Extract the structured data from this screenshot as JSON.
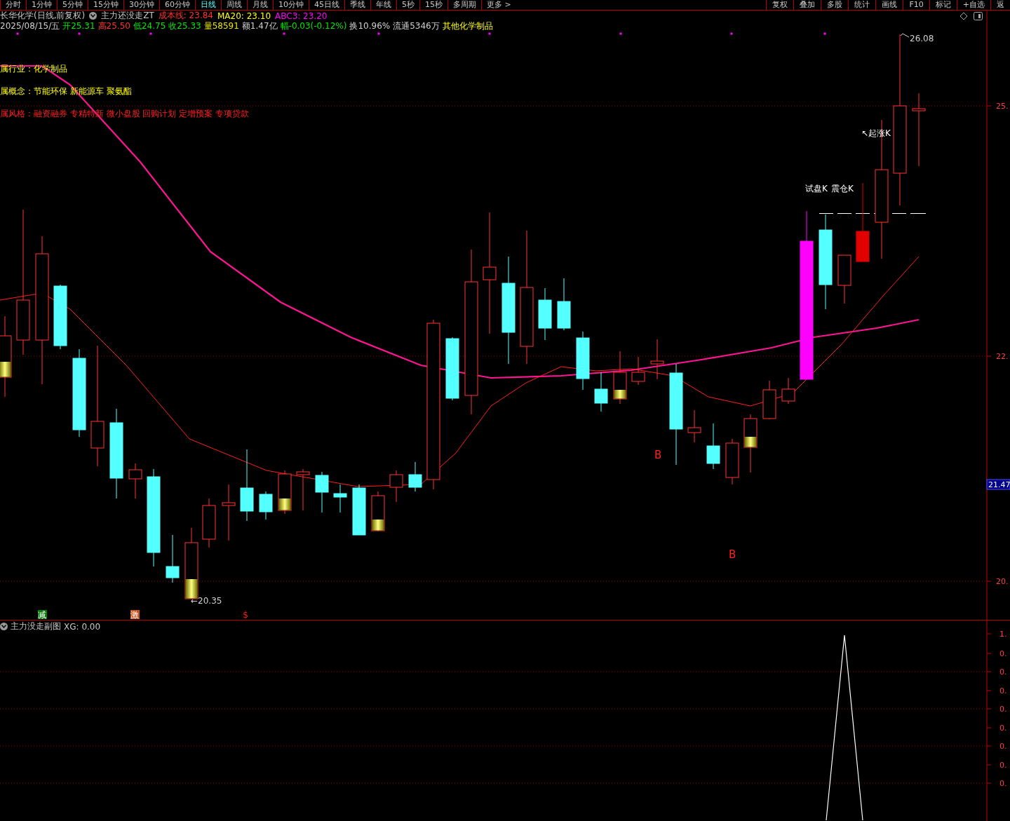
{
  "toolbar": {
    "periods": [
      {
        "label": "分时",
        "selected": false
      },
      {
        "label": "1分钟",
        "selected": false
      },
      {
        "label": "5分钟",
        "selected": false
      },
      {
        "label": "15分钟",
        "selected": false
      },
      {
        "label": "30分钟",
        "selected": false
      },
      {
        "label": "60分钟",
        "selected": false
      },
      {
        "label": "日线",
        "selected": true
      },
      {
        "label": "周线",
        "selected": false
      },
      {
        "label": "月线",
        "selected": false
      },
      {
        "label": "10分钟",
        "selected": false
      },
      {
        "label": "45日线",
        "selected": false
      },
      {
        "label": "季线",
        "selected": false
      },
      {
        "label": "年线",
        "selected": false
      },
      {
        "label": "5秒",
        "selected": false
      },
      {
        "label": "15秒",
        "selected": false
      },
      {
        "label": "多周期",
        "selected": false
      },
      {
        "label": "更多 >",
        "selected": false
      }
    ],
    "tools": [
      "复权",
      "叠加",
      "多股",
      "统计",
      "画线",
      "F10",
      "标记",
      "+自选",
      "返"
    ]
  },
  "header": {
    "title": "长华化学(日线,前复权)",
    "indicator": "主力还没走ZT",
    "values": [
      {
        "text": "成本线: 23.84",
        "kind": "cost"
      },
      {
        "text": "MA20: 23.10",
        "kind": "ma"
      },
      {
        "text": "ABC3: 23.20",
        "kind": "abc"
      }
    ]
  },
  "quote": {
    "date": "2025/08/15/五",
    "fields": [
      {
        "text": "开25.31",
        "kind": "down"
      },
      {
        "text": "高25.50",
        "kind": "up"
      },
      {
        "text": "低24.75",
        "kind": "down"
      },
      {
        "text": "收25.33",
        "kind": "down"
      },
      {
        "text": "量58591",
        "kind": "volume"
      },
      {
        "text": "额1.47亿",
        "kind": "plain"
      },
      {
        "text": "幅-0.03(-0.12%)",
        "kind": "down"
      },
      {
        "text": "换10.96%",
        "kind": "plain"
      },
      {
        "text": "流通5346万",
        "kind": "plain"
      }
    ],
    "sector": "其他化学制品"
  },
  "info_lines": [
    {
      "label": "属行业：",
      "value": "化学制品",
      "kind": "industry"
    },
    {
      "label": "属概念：",
      "value": "节能环保 新能源车 聚氨酯",
      "kind": "concept"
    },
    {
      "label": "属风格：",
      "value": "融资融券 专精特新 微小盘股 回购计划 定增预案 专项贷款",
      "kind": "style"
    }
  ],
  "chart": {
    "price_ticks": [
      "25.",
      "22.",
      "20."
    ],
    "current_price": "21.47",
    "high_label": "26.08",
    "low_label": "←20.35",
    "annotations": [
      {
        "text": "↖起涨K",
        "kind": "marker"
      },
      {
        "text": "试盘K",
        "kind": "marker"
      },
      {
        "text": "震仓K",
        "kind": "marker"
      },
      {
        "text": "B",
        "kind": "buy"
      },
      {
        "text": "B",
        "kind": "buy"
      }
    ],
    "signals": [
      {
        "text": "减",
        "kind": "reduce"
      },
      {
        "text": "激",
        "kind": "surge"
      },
      {
        "text": "$",
        "kind": "dollar"
      }
    ]
  },
  "sub_pane": {
    "title": "主力没走副图",
    "value": "XG: 0.00",
    "ticks": [
      "1.",
      "0.",
      "0.",
      "0.",
      "0.",
      "0.",
      "0.",
      "0.",
      "0."
    ]
  }
}
